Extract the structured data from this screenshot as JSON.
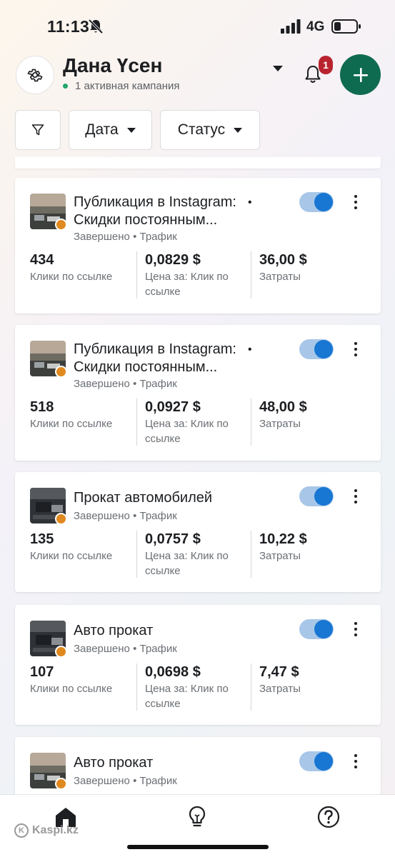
{
  "status_bar": {
    "time": "11:13",
    "network": "4G",
    "icons": [
      "bell-off-icon",
      "signal-icon",
      "battery-icon"
    ]
  },
  "header": {
    "account_name": "Дана Үсен",
    "account_status": "1 активная кампания",
    "notification_count": "1",
    "icons": [
      "gear-icon",
      "caret-down-icon",
      "bell-icon",
      "plus-icon"
    ],
    "colors": {
      "add_button": "#0f6b4f",
      "badge": "#b8232f",
      "status_dot": "#23a56d"
    }
  },
  "filters": {
    "date_label": "Дата",
    "status_label": "Статус",
    "icons": [
      "filter-icon",
      "caret-down-icon"
    ]
  },
  "campaigns": [
    {
      "title": "Публикация в Instagram: Скидки постоянным...",
      "bullet": "•",
      "status": "Завершено",
      "separator": "•",
      "objective": "Трафик",
      "active": true,
      "metrics": [
        {
          "value": "434",
          "label": "Клики по ссылке"
        },
        {
          "value": "0,0829 $",
          "label": "Цена за: Клик по ссылке"
        },
        {
          "value": "36,00 $",
          "label": "Затраты"
        }
      ]
    },
    {
      "title": "Публикация в Instagram: Скидки постоянным...",
      "bullet": "•",
      "status": "Завершено",
      "separator": "•",
      "objective": "Трафик",
      "active": true,
      "metrics": [
        {
          "value": "518",
          "label": "Клики по ссылке"
        },
        {
          "value": "0,0927 $",
          "label": "Цена за: Клик по ссылке"
        },
        {
          "value": "48,00 $",
          "label": "Затраты"
        }
      ]
    },
    {
      "title": "Прокат автомобилей",
      "status": "Завершено",
      "separator": "•",
      "objective": "Трафик",
      "active": true,
      "metrics": [
        {
          "value": "135",
          "label": "Клики по ссылке"
        },
        {
          "value": "0,0757 $",
          "label": "Цена за: Клик по ссылке"
        },
        {
          "value": "10,22 $",
          "label": "Затраты"
        }
      ]
    },
    {
      "title": "Авто прокат",
      "status": "Завершено",
      "separator": "•",
      "objective": "Трафик",
      "active": true,
      "metrics": [
        {
          "value": "107",
          "label": "Клики по ссылке"
        },
        {
          "value": "0,0698 $",
          "label": "Цена за: Клик по ссылке"
        },
        {
          "value": "7,47 $",
          "label": "Затраты"
        }
      ]
    },
    {
      "title": "Авто прокат",
      "status": "Завершено",
      "separator": "•",
      "objective": "Трафик",
      "active": true
    }
  ],
  "bottom_nav": {
    "items": [
      "home-icon",
      "lightbulb-icon",
      "help-icon"
    ]
  },
  "watermark": "Kaspi.kz"
}
